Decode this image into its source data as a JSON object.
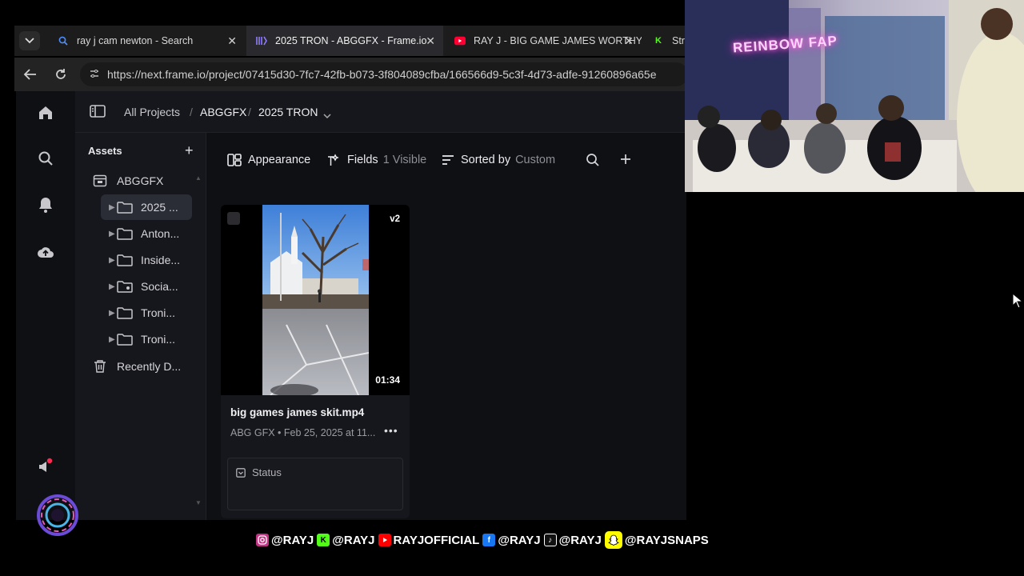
{
  "browser": {
    "tabs": [
      {
        "title": "ray j cam newton - Search",
        "icon": "search-icon",
        "active": false
      },
      {
        "title": "2025 TRON - ABGGFX - Frame.io",
        "icon": "frameio-icon",
        "active": true
      },
      {
        "title": "RAY J - BIG GAME JAMES WORTHY",
        "icon": "youtube-icon",
        "active": false
      },
      {
        "title": "Stre",
        "icon": "kick-icon",
        "active": false
      }
    ],
    "url": "https://next.frame.io/project/07415d30-7fc7-42fb-b073-3f804089cfba/166566d9-5c3f-4d73-adfe-91260896a65e"
  },
  "app": {
    "breadcrumb": {
      "all_projects": "All Projects",
      "separator": "/",
      "workspace": "ABGGFX",
      "project": "2025 TRON"
    },
    "sidebar": {
      "title": "Assets",
      "root": "ABGGFX",
      "folders": [
        {
          "label": "2025 ...",
          "selected": true
        },
        {
          "label": "Anton...",
          "selected": false
        },
        {
          "label": "Inside...",
          "selected": false
        },
        {
          "label": "Socia...",
          "selected": false
        },
        {
          "label": "Troni...",
          "selected": false
        },
        {
          "label": "Troni...",
          "selected": false
        }
      ],
      "trash": "Recently D..."
    },
    "toolbar": {
      "appearance": "Appearance",
      "fields": "Fields",
      "fields_count": "1 Visible",
      "sorted_by": "Sorted by",
      "sort_value": "Custom"
    },
    "asset": {
      "version": "v2",
      "duration": "01:34",
      "filename": "big games james skit.mp4",
      "meta": "ABG GFX • Feb 25, 2025 at 11...",
      "more": "•••",
      "status_label": "Status"
    }
  },
  "overlay": {
    "cam_sign": "REINBOW FAP",
    "socials": [
      {
        "icon": "instagram-icon",
        "handle": "@RAYJ",
        "color": "#c13584"
      },
      {
        "icon": "kick-icon",
        "handle": "@RAYJ",
        "color": "#53fc18"
      },
      {
        "icon": "youtube-icon",
        "handle": "RAYJOFFICIAL",
        "color": "#ff0000"
      },
      {
        "icon": "facebook-icon",
        "handle": "@RAYJ",
        "color": "#1877f2"
      },
      {
        "icon": "tiktok-icon",
        "handle": "@RAYJ",
        "color": "#111111"
      },
      {
        "icon": "snapchat-icon",
        "handle": "@RAYJSNAPS",
        "color": "#fffc00"
      }
    ]
  }
}
